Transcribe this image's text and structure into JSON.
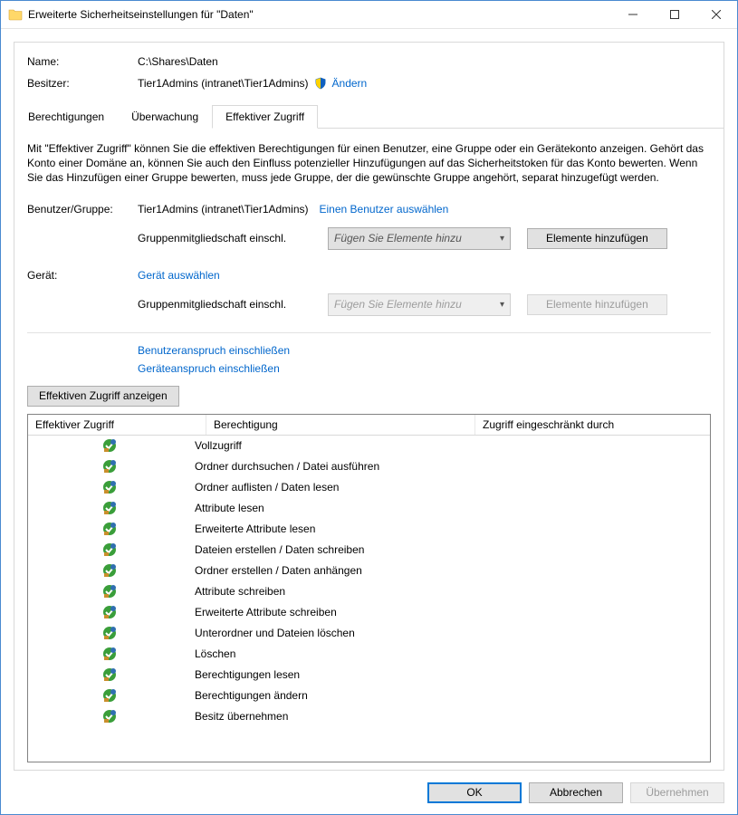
{
  "window": {
    "title": "Erweiterte Sicherheitseinstellungen für \"Daten\""
  },
  "header": {
    "name_label": "Name:",
    "name_value": "C:\\Shares\\Daten",
    "owner_label": "Besitzer:",
    "owner_value": "Tier1Admins (intranet\\Tier1Admins)",
    "change_link": "Ändern"
  },
  "tabs": [
    "Berechtigungen",
    "Überwachung",
    "Effektiver Zugriff"
  ],
  "active_tab": 2,
  "description": "Mit \"Effektiver Zugriff\" können Sie die effektiven Berechtigungen für einen Benutzer, eine Gruppe oder ein Gerätekonto anzeigen. Gehört das Konto einer Domäne an, können Sie auch den Einfluss potenzieller Hinzufügungen auf das Sicherheitstoken für das Konto bewerten. Wenn Sie das Hinzufügen einer Gruppe bewerten, muss jede Gruppe, der die gewünschte Gruppe angehört, separat hinzugefügt werden.",
  "user_section": {
    "label": "Benutzer/Gruppe:",
    "value": "Tier1Admins (intranet\\Tier1Admins)",
    "select_link": "Einen Benutzer auswählen",
    "membership_label": "Gruppenmitgliedschaft einschl.",
    "combo_placeholder": "Fügen Sie Elemente hinzu",
    "add_button": "Elemente hinzufügen"
  },
  "device_section": {
    "label": "Gerät:",
    "select_link": "Gerät auswählen",
    "membership_label": "Gruppenmitgliedschaft einschl.",
    "combo_placeholder": "Fügen Sie Elemente hinzu",
    "add_button": "Elemente hinzufügen"
  },
  "claim_links": {
    "user": "Benutzeranspruch einschließen",
    "device": "Geräteanspruch einschließen"
  },
  "view_button": "Effektiven Zugriff anzeigen",
  "table": {
    "headers": [
      "Effektiver Zugriff",
      "Berechtigung",
      "Zugriff eingeschränkt durch"
    ],
    "rows": [
      {
        "perm": "Vollzugriff"
      },
      {
        "perm": "Ordner durchsuchen / Datei ausführen"
      },
      {
        "perm": "Ordner auflisten / Daten lesen"
      },
      {
        "perm": "Attribute lesen"
      },
      {
        "perm": "Erweiterte Attribute lesen"
      },
      {
        "perm": "Dateien erstellen / Daten schreiben"
      },
      {
        "perm": "Ordner erstellen / Daten anhängen"
      },
      {
        "perm": "Attribute schreiben"
      },
      {
        "perm": "Erweiterte Attribute schreiben"
      },
      {
        "perm": "Unterordner und Dateien löschen"
      },
      {
        "perm": "Löschen"
      },
      {
        "perm": "Berechtigungen lesen"
      },
      {
        "perm": "Berechtigungen ändern"
      },
      {
        "perm": "Besitz übernehmen"
      }
    ]
  },
  "footer": {
    "ok": "OK",
    "cancel": "Abbrechen",
    "apply": "Übernehmen"
  }
}
